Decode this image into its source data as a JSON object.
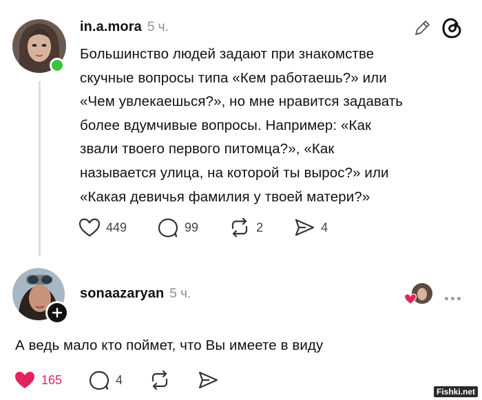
{
  "post": {
    "username": "in.a.mora",
    "time": "5 ч.",
    "text": "Большинство людей задают при знакомстве\nскучные вопросы типа «Кем работаешь?» или\n«Чем увлекаешься?», но мне нравится задавать\nболее вдумчивые вопросы. Например: «Как\nзвали твоего первого питомца?», «Как\nназывается улица, на которой ты вырос?» или\n«Какая девичья фамилия у твоей матери?»",
    "likes": "449",
    "comments": "99",
    "reposts": "2",
    "shares": "4",
    "online_color": "#3ec13e"
  },
  "reply": {
    "username": "sonaazaryan",
    "time": "5 ч.",
    "text": "А ведь мало кто поймет, что Вы имеете в виду",
    "likes": "165",
    "comments": "4",
    "like_color": "#e0245e"
  },
  "watermark": "Fishki.net"
}
